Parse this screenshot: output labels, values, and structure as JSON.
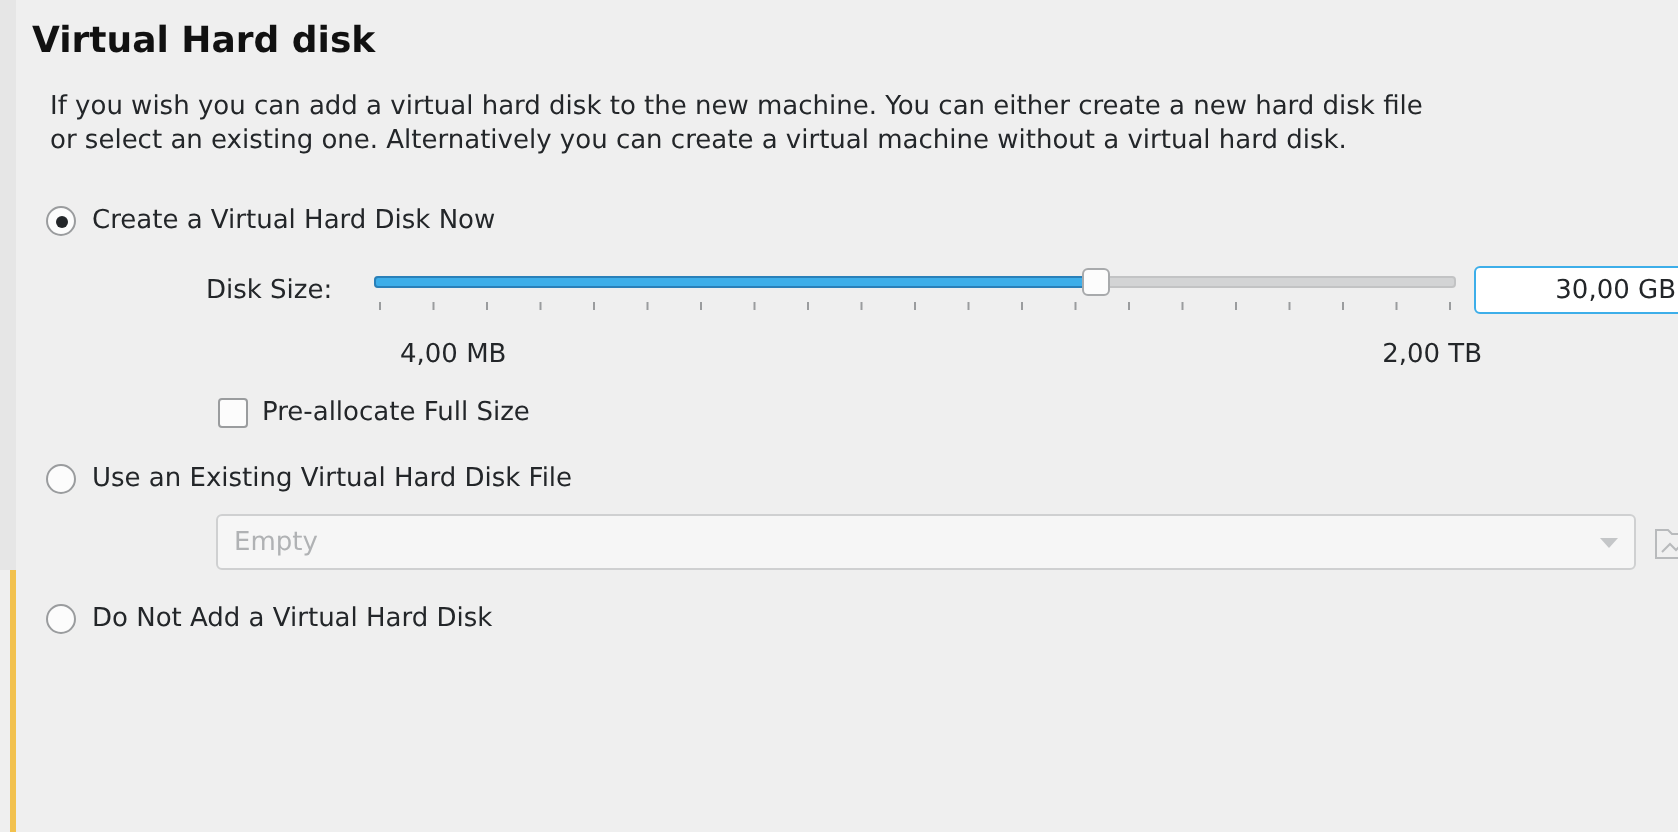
{
  "title": "Virtual Hard disk",
  "description": "If you wish you can add a virtual hard disk to the new machine. You can either create a new hard disk file or select an existing one. Alternatively you can create a virtual machine without a virtual hard disk.",
  "options": [
    {
      "label": "Create a Virtual Hard Disk Now",
      "selected": true
    },
    {
      "label": "Use an Existing Virtual Hard Disk File",
      "selected": false
    },
    {
      "label": "Do Not Add a Virtual Hard Disk",
      "selected": false
    }
  ],
  "disk_size": {
    "label": "Disk Size:",
    "level": 0.667,
    "value": "30,00 GB",
    "min_label": "4,00 MB",
    "max_label": "2,00 TB"
  },
  "preallocate": {
    "label": "Pre-allocate Full Size",
    "checked": false
  },
  "existing_file": {
    "placeholder": "Empty",
    "disabled": true
  }
}
